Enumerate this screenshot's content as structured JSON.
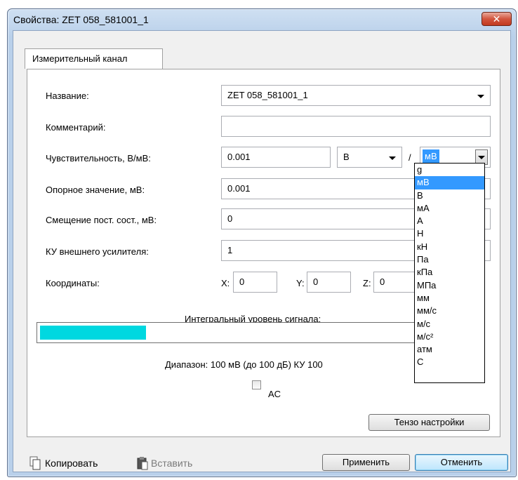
{
  "window": {
    "title": "Свойства: ZET 058_581001_1",
    "close_glyph": "✕"
  },
  "tab": {
    "label": "Измерительный канал"
  },
  "form": {
    "name_label": "Название:",
    "name_value": "ZET 058_581001_1",
    "comment_label": "Комментарий:",
    "comment_value": "",
    "sensitivity_label": "Чувствительность, В/мВ:",
    "sensitivity_value": "0.001",
    "sensitivity_unit_num": "В",
    "sensitivity_separator": "/",
    "sensitivity_unit_den": "мВ",
    "reference_label": "Опорное значение, мВ:",
    "reference_value": "0.001",
    "offset_label": "Смещение пост. сост., мВ:",
    "offset_value": "0",
    "gain_label": "КУ внешнего усилителя:",
    "gain_value": "1",
    "coords_label": "Координаты:",
    "x_label": "X:",
    "x_value": "0",
    "y_label": "Y:",
    "y_value": "0",
    "z_label": "Z:",
    "z_value": "0"
  },
  "unit_dropdown": {
    "options": [
      "g",
      "мВ",
      "В",
      "мА",
      "А",
      "Н",
      "кН",
      "Па",
      "кПа",
      "МПа",
      "мм",
      "мм/с",
      "м/с",
      "м/с²",
      "атм",
      "С"
    ],
    "selected_index": 1
  },
  "signal": {
    "label": "Интегральный уровень сигнала:",
    "level_fraction": 0.24,
    "fill_color": "#00d8e0",
    "range_text": "Диапазон: 100 мВ (до 100 дБ) КУ 100"
  },
  "ac_checkbox": {
    "label": "AC",
    "checked": false
  },
  "buttons": {
    "tenso": "Тензо настройки",
    "copy": "Копировать",
    "paste": "Вставить",
    "apply": "Применить",
    "cancel": "Отменить"
  }
}
